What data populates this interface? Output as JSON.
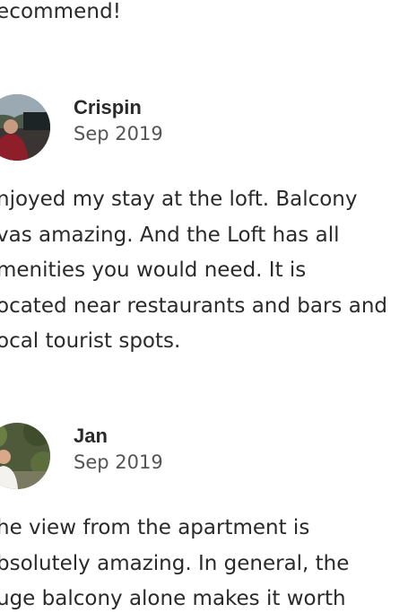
{
  "previous_review": {
    "tail_text": "ecommend!"
  },
  "reviews": [
    {
      "name": "Crispin",
      "date": "Sep 2019",
      "avatar": "crispin-avatar",
      "lines": [
        "njoyed my stay at the loft. Balcony",
        "vas amazing. And the Loft has all",
        "menities you would need. It is",
        "ocated near restaurants and bars and",
        "ocal tourist spots."
      ]
    },
    {
      "name": "Jan",
      "date": "Sep 2019",
      "avatar": "jan-avatar",
      "lines": [
        "he view from the apartment is",
        "bsolutely amazing. In general, the",
        "uge balcony alone makes it worth"
      ]
    }
  ]
}
